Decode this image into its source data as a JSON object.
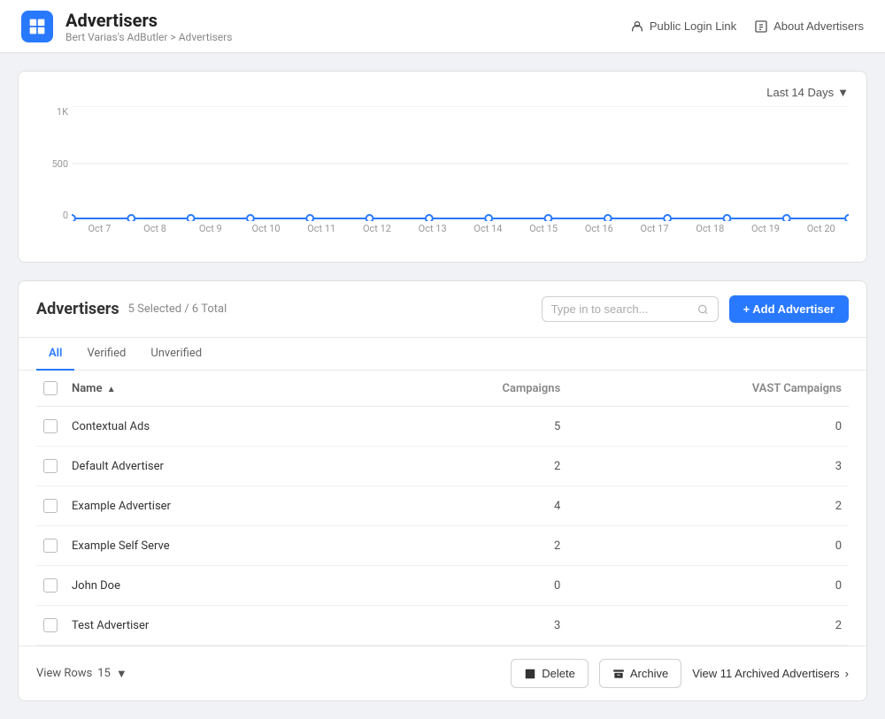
{
  "header": {
    "app_icon_label": "AdButler",
    "title": "Advertisers",
    "breadcrumb_parent": "Bert Varias's AdButler",
    "breadcrumb_separator": " > ",
    "breadcrumb_current": "Advertisers",
    "public_login_btn": "Public Login Link",
    "about_btn": "About Advertisers"
  },
  "chart": {
    "date_range_btn": "Last 14 Days",
    "y_labels": [
      "1K",
      "500",
      "0"
    ],
    "x_labels": [
      "Oct 7",
      "Oct 8",
      "Oct 9",
      "Oct 10",
      "Oct 11",
      "Oct 12",
      "Oct 13",
      "Oct 14",
      "Oct 15",
      "Oct 16",
      "Oct 17",
      "Oct 18",
      "Oct 19",
      "Oct 20"
    ],
    "line_color": "#2979ff",
    "grid_color": "#e8e8e8"
  },
  "advertisers": {
    "title": "Advertisers",
    "count_selected": 5,
    "count_total": 6,
    "count_label": "5 Selected / 6 Total",
    "search_placeholder": "Type in to search...",
    "add_btn_label": "+ Add Advertiser",
    "tabs": [
      {
        "id": "all",
        "label": "All",
        "active": true
      },
      {
        "id": "verified",
        "label": "Verified",
        "active": false
      },
      {
        "id": "unverified",
        "label": "Unverified",
        "active": false
      }
    ],
    "columns": {
      "name": "Name",
      "campaigns": "Campaigns",
      "vast_campaigns": "VAST Campaigns"
    },
    "rows": [
      {
        "name": "Contextual Ads",
        "campaigns": 5,
        "vast_campaigns": 0
      },
      {
        "name": "Default Advertiser",
        "campaigns": 2,
        "vast_campaigns": 3
      },
      {
        "name": "Example Advertiser",
        "campaigns": 4,
        "vast_campaigns": 2
      },
      {
        "name": "Example Self Serve",
        "campaigns": 2,
        "vast_campaigns": 0
      },
      {
        "name": "John Doe",
        "campaigns": 0,
        "vast_campaigns": 0
      },
      {
        "name": "Test Advertiser",
        "campaigns": 3,
        "vast_campaigns": 2
      }
    ],
    "view_rows_label": "View Rows",
    "view_rows_count": "15",
    "delete_btn": "Delete",
    "archive_btn": "Archive",
    "view_archived_btn": "View 11 Archived Advertisers"
  }
}
